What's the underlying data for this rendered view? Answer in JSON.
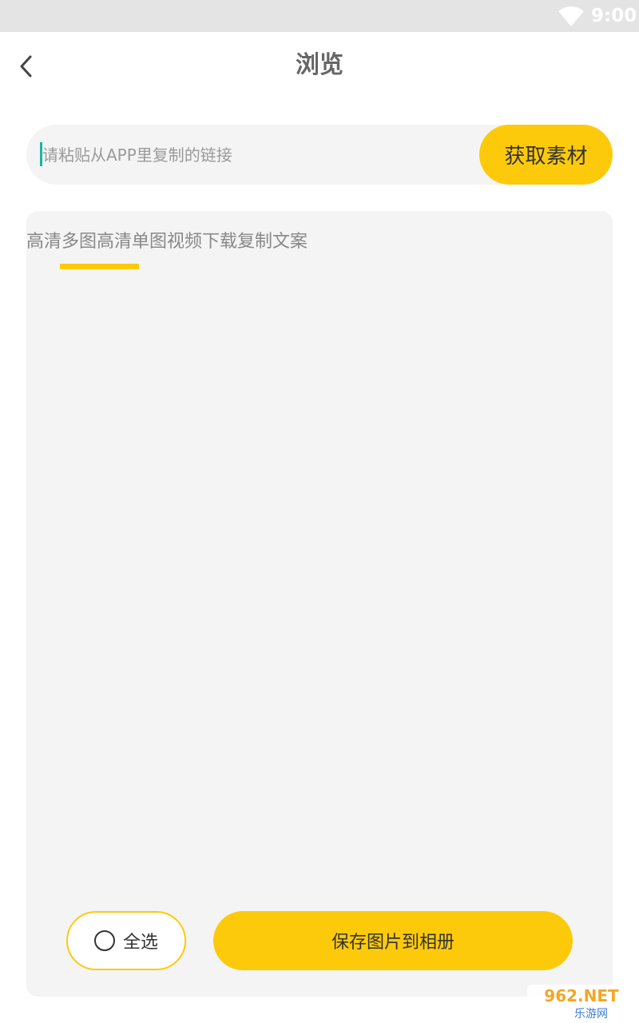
{
  "status_bar": {
    "time": "9:00",
    "icons": [
      "wifi-icon"
    ]
  },
  "app_bar": {
    "title": "浏览",
    "back_icon": "chevron-left-icon"
  },
  "search": {
    "placeholder": "请粘贴从APP里复制的链接",
    "value": "",
    "button_label": "获取素材"
  },
  "tabs": [
    {
      "label": "高清多图",
      "active": true
    },
    {
      "label": "高清单图",
      "active": false
    },
    {
      "label": "视频下载",
      "active": false
    },
    {
      "label": "复制文案",
      "active": false
    }
  ],
  "footer": {
    "select_all_label": "全选",
    "save_label": "保存图片到相册"
  },
  "watermark": {
    "text_top": "962.NET",
    "text_bottom": "乐游网"
  },
  "colors": {
    "accent": "#fdca0b",
    "caret": "#1bb5a4",
    "card_bg": "#f4f4f4",
    "status_bar_bg": "#e4e4e4"
  }
}
